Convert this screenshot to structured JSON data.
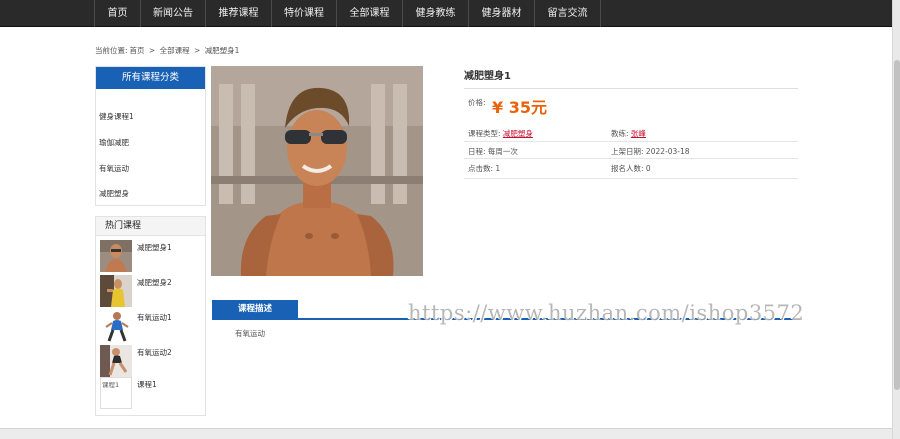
{
  "nav": {
    "items": [
      {
        "label": "首页"
      },
      {
        "label": "新闻公告"
      },
      {
        "label": "推荐课程"
      },
      {
        "label": "特价课程"
      },
      {
        "label": "全部课程"
      },
      {
        "label": "健身教练"
      },
      {
        "label": "健身器材"
      },
      {
        "label": "留言交流"
      }
    ]
  },
  "breadcrumb": {
    "prefix": "当前位置:",
    "home": "首页",
    "sep1": ">",
    "category": "全部课程",
    "sep2": ">",
    "current": "减肥塑身1"
  },
  "categories": {
    "title": "所有课程分类",
    "items": [
      "健身课程1",
      "瑜伽减肥",
      "有氧运动",
      "减肥塑身"
    ]
  },
  "hot": {
    "title": "热门课程",
    "items": [
      {
        "label": "减肥塑身1"
      },
      {
        "label": "减肥塑身2"
      },
      {
        "label": "有氧运动1"
      },
      {
        "label": "有氧运动2"
      },
      {
        "label": "课程1",
        "alt": "课程1"
      }
    ]
  },
  "product": {
    "title": "减肥塑身1",
    "price_label": "价格:",
    "price": "¥ 35元",
    "type_label": "课程类型:",
    "type_value": "减肥塑身",
    "coach_label": "教练:",
    "coach_value": "张峰",
    "schedule_label": "日程:",
    "schedule_value": "每周一次",
    "date_label": "上架日期:",
    "date_value": "2022-03-18",
    "clicks_label": "点击数:",
    "clicks_value": "1",
    "signup_label": "报名人数:",
    "signup_value": "0"
  },
  "description": {
    "tab": "课程描述",
    "text": "有氧运动"
  },
  "watermark": "https://www.huzhan.com/ishop3572",
  "colors": {
    "nav_bg": "#2a2a2a",
    "accent_blue": "#1961b5",
    "price": "#e8630a",
    "link_red": "#c4122f"
  }
}
